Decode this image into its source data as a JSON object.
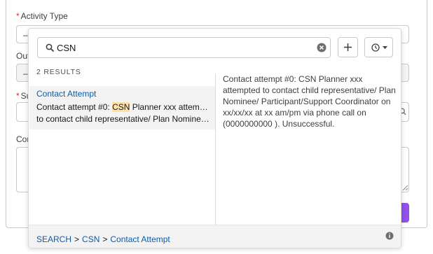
{
  "form": {
    "activity_type_label": "Activity Type",
    "required_marker": "*",
    "outcome_label_fragment": "Out",
    "subject_label_fragment": "Su",
    "comments_label_fragment": "Cor",
    "dash": "–"
  },
  "lookup": {
    "search_value": "CSN",
    "results_count": "2 RESULTS",
    "result": {
      "title": "Contact Attempt",
      "snippet_prefix": "Contact attempt #0: ",
      "snippet_highlight": "CSN",
      "snippet_rest": " Planner xxx attempted",
      "snippet_line2": "to contact child representative/ Plan Nominee..."
    },
    "preview_text": "Contact attempt #0: CSN Planner xxx attempted to contact child representative/ Plan Nominee/ Participant/Support Coordinator on xx/xx/xx at xx am/pm via phone call on (0000000000 ). Unsuccessful.",
    "breadcrumb": {
      "search": "SEARCH",
      "sep": ">",
      "query": "CSN",
      "template": "Contact Attempt"
    }
  },
  "colors": {
    "link": "#0b5cab",
    "highlight": "#ffe1a8",
    "brand_button": "#9050e9"
  },
  "icons": [
    "search-icon",
    "clear-icon",
    "plus-icon",
    "clock-icon",
    "chevron-down-icon",
    "info-icon",
    "magnifier-icon"
  ]
}
